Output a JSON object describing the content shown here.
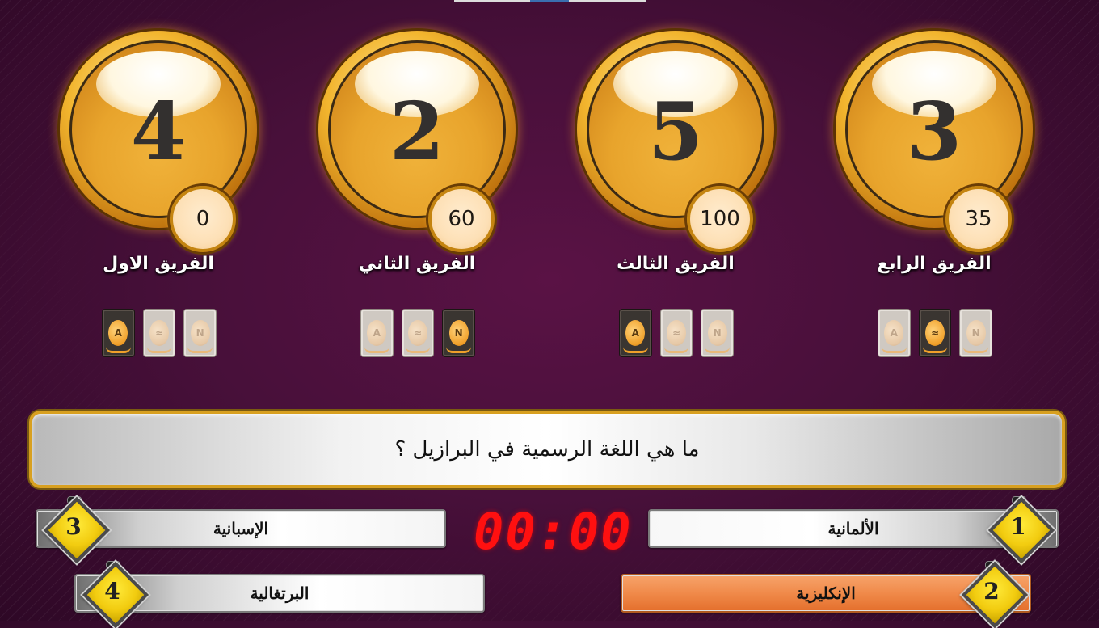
{
  "teams": [
    {
      "name": "الفريق الاول",
      "number": "4",
      "score": "0",
      "jokers": [
        "active",
        "inactive",
        "inactive"
      ]
    },
    {
      "name": "الفريق الثاني",
      "number": "2",
      "score": "60",
      "jokers": [
        "inactive",
        "inactive",
        "active"
      ]
    },
    {
      "name": "الفريق الثالث",
      "number": "5",
      "score": "100",
      "jokers": [
        "active",
        "inactive",
        "inactive"
      ]
    },
    {
      "name": "الفريق الرابع",
      "number": "3",
      "score": "35",
      "jokers": [
        "inactive",
        "active",
        "inactive"
      ]
    }
  ],
  "question": {
    "text": "ما هي اللغة الرسمية في البرازيل ؟"
  },
  "timer": {
    "display": "00:00"
  },
  "answers": [
    {
      "number": "1",
      "label": "الألمانية",
      "selected": false
    },
    {
      "number": "2",
      "label": "الإنكليزية",
      "selected": true
    },
    {
      "number": "3",
      "label": "الإسبانية",
      "selected": false
    },
    {
      "number": "4",
      "label": "البرتغالية",
      "selected": false
    }
  ],
  "joker_glyphs": [
    "A",
    "≈",
    "N"
  ],
  "colors": {
    "background": "#48103a",
    "gold": "#d8a020",
    "selected_answer": "#f08a4a",
    "timer": "#ff1010"
  }
}
